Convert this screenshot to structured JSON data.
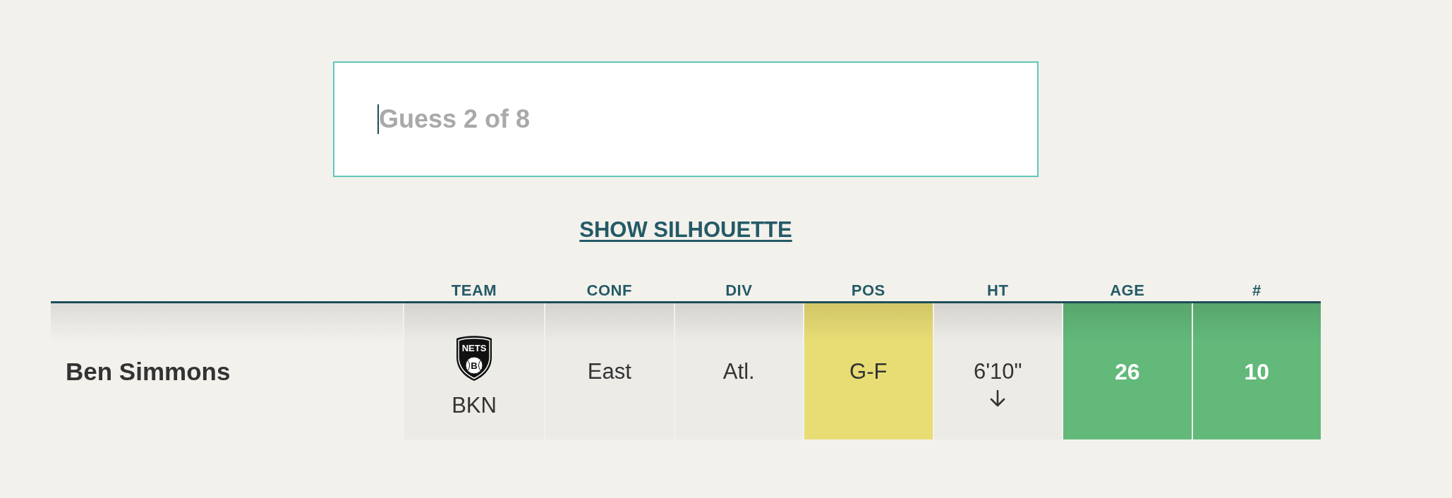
{
  "guess_input": {
    "placeholder": "Guess 2 of 8",
    "focused": true
  },
  "silhouette_link": {
    "label": "SHOW SILHOUETTE"
  },
  "table": {
    "columns": [
      "TEAM",
      "CONF",
      "DIV",
      "POS",
      "HT",
      "AGE",
      "#"
    ],
    "rows": [
      {
        "player": "Ben Simmons",
        "cells": [
          {
            "kind": "team",
            "value": "BKN",
            "correct": false,
            "close": false,
            "higher": false,
            "lower": false,
            "logo": {
              "wordmark": "NETS",
              "letter": "B"
            }
          },
          {
            "kind": "text",
            "value": "East",
            "correct": false,
            "close": false,
            "higher": false,
            "lower": false
          },
          {
            "kind": "text",
            "value": "Atl.",
            "correct": false,
            "close": false,
            "higher": false,
            "lower": false
          },
          {
            "kind": "text",
            "value": "G-F",
            "correct": false,
            "close": true,
            "higher": false,
            "lower": false
          },
          {
            "kind": "text",
            "value": "6'10\"",
            "correct": false,
            "close": false,
            "higher": false,
            "lower": true
          },
          {
            "kind": "text",
            "value": "26",
            "correct": true,
            "close": false,
            "higher": false,
            "lower": false
          },
          {
            "kind": "text",
            "value": "10",
            "correct": true,
            "close": false,
            "higher": false,
            "lower": false
          }
        ]
      }
    ]
  }
}
